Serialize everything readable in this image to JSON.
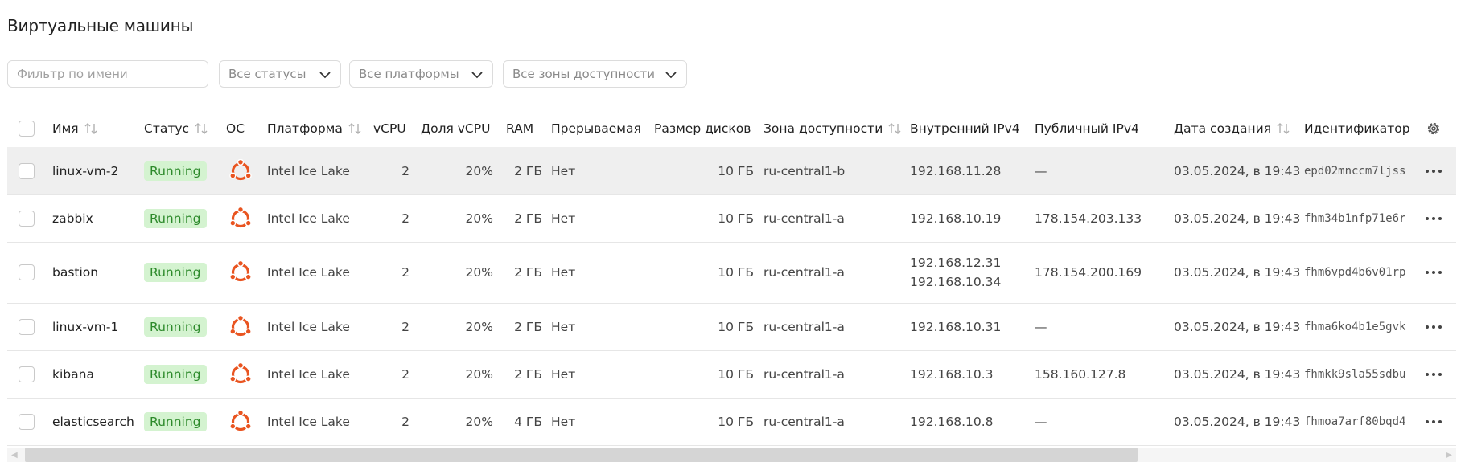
{
  "page": {
    "title": "Виртуальные машины"
  },
  "filters": {
    "name_placeholder": "Фильтр по имени",
    "status_select": "Все статусы",
    "platform_select": "Все платформы",
    "zone_select": "Все зоны доступности"
  },
  "colors": {
    "running_bg": "#d4f3d0",
    "running_text": "#2d8a2b",
    "ubuntu": "#e95420",
    "selected_row": "#efefef"
  },
  "table": {
    "headers": {
      "name": "Имя",
      "status": "Статус",
      "os": "ОС",
      "platform": "Платформа",
      "vcpu": "vCPU",
      "vcpu_share": "Доля vCPU",
      "ram": "RAM",
      "preemptible": "Прерываемая",
      "disk_size": "Размер дисков",
      "zone": "Зона доступности",
      "internal_ip": "Внутренний IPv4",
      "public_ip": "Публичный IPv4",
      "created": "Дата создания",
      "id": "Идентификатор"
    },
    "rows": [
      {
        "name": "linux-vm-2",
        "status": "Running",
        "os_icon": "ubuntu-icon",
        "platform": "Intel Ice Lake",
        "vcpu": "2",
        "vcpu_share": "20%",
        "ram": "2 ГБ",
        "preemptible": "Нет",
        "disk": "10 ГБ",
        "zone": "ru-central1-b",
        "internal_ips": [
          "192.168.11.28"
        ],
        "public_ip": "—",
        "created": "03.05.2024, в 19:43",
        "id": "epd02mnccm7ljss"
      },
      {
        "name": "zabbix",
        "status": "Running",
        "os_icon": "ubuntu-icon",
        "platform": "Intel Ice Lake",
        "vcpu": "2",
        "vcpu_share": "20%",
        "ram": "2 ГБ",
        "preemptible": "Нет",
        "disk": "10 ГБ",
        "zone": "ru-central1-a",
        "internal_ips": [
          "192.168.10.19"
        ],
        "public_ip": "178.154.203.133",
        "created": "03.05.2024, в 19:43",
        "id": "fhm34b1nfp71e6r"
      },
      {
        "name": "bastion",
        "status": "Running",
        "os_icon": "ubuntu-icon",
        "platform": "Intel Ice Lake",
        "vcpu": "2",
        "vcpu_share": "20%",
        "ram": "2 ГБ",
        "preemptible": "Нет",
        "disk": "10 ГБ",
        "zone": "ru-central1-a",
        "internal_ips": [
          "192.168.12.31",
          "192.168.10.34"
        ],
        "public_ip": "178.154.200.169",
        "created": "03.05.2024, в 19:43",
        "id": "fhm6vpd4b6v01rp"
      },
      {
        "name": "linux-vm-1",
        "status": "Running",
        "os_icon": "ubuntu-icon",
        "platform": "Intel Ice Lake",
        "vcpu": "2",
        "vcpu_share": "20%",
        "ram": "2 ГБ",
        "preemptible": "Нет",
        "disk": "10 ГБ",
        "zone": "ru-central1-a",
        "internal_ips": [
          "192.168.10.31"
        ],
        "public_ip": "—",
        "created": "03.05.2024, в 19:43",
        "id": "fhma6ko4b1e5gvk"
      },
      {
        "name": "kibana",
        "status": "Running",
        "os_icon": "ubuntu-icon",
        "platform": "Intel Ice Lake",
        "vcpu": "2",
        "vcpu_share": "20%",
        "ram": "2 ГБ",
        "preemptible": "Нет",
        "disk": "10 ГБ",
        "zone": "ru-central1-a",
        "internal_ips": [
          "192.168.10.3"
        ],
        "public_ip": "158.160.127.8",
        "created": "03.05.2024, в 19:43",
        "id": "fhmkk9sla55sdbu"
      },
      {
        "name": "elasticsearch",
        "status": "Running",
        "os_icon": "ubuntu-icon",
        "platform": "Intel Ice Lake",
        "vcpu": "2",
        "vcpu_share": "20%",
        "ram": "4 ГБ",
        "preemptible": "Нет",
        "disk": "10 ГБ",
        "zone": "ru-central1-a",
        "internal_ips": [
          "192.168.10.8"
        ],
        "public_ip": "—",
        "created": "03.05.2024, в 19:43",
        "id": "fhmoa7arf80bqd4"
      }
    ]
  }
}
